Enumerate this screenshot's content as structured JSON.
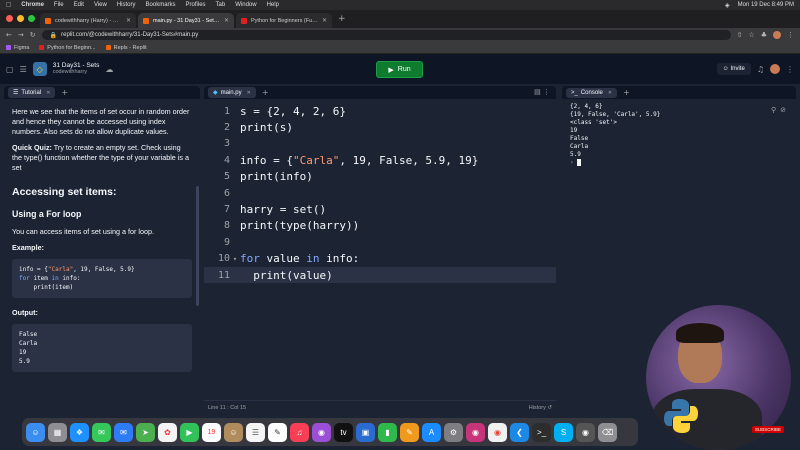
{
  "menubar": {
    "app": "Chrome",
    "items": [
      "File",
      "Edit",
      "View",
      "History",
      "Bookmarks",
      "Profiles",
      "Tab",
      "Window",
      "Help"
    ],
    "clock": "Mon 19 Dec 8:49 PM"
  },
  "tabs": [
    {
      "label": "codewithharry (Harry) - Replit",
      "icon": "replit-icon"
    },
    {
      "label": "main.py - 31 Day31 - Sets - Re...",
      "icon": "replit-icon"
    },
    {
      "label": "Python for Beginners (Full Co...",
      "icon": "youtube-icon"
    }
  ],
  "url": "replit.com/@codewithharry/31-Day31-Sets#main.py",
  "bookmarks": [
    "Figma",
    "Python for Beginn...",
    "Repls - Replit"
  ],
  "repl": {
    "title": "31 Day31 - Sets",
    "owner": "codewithharry",
    "run_label": "Run",
    "invite_label": "Invite"
  },
  "tutorial": {
    "tab_label": "Tutorial",
    "para1": "Here we see that the items of set occur in random order and hence they cannot be accessed using index numbers. Also sets do not allow duplicate values.",
    "quiz_label": "Quick Quiz:",
    "quiz_text": " Try to create an empty set. Check using the type() function whether the type of your variable is a set",
    "h2": "Accessing set items:",
    "h3": "Using a For loop",
    "para2": "You can access items of set using a for loop.",
    "example_label": "Example:",
    "example_code": [
      "info = {\"Carla\", 19, False, 5.9}",
      "for item in info:",
      "    print(item)"
    ],
    "output_label": "Output:",
    "output_lines": [
      "False",
      "Carla",
      "19",
      "5.9"
    ]
  },
  "editor": {
    "tab_label": "main.py",
    "lines": [
      "s = {2, 4, 2, 6}",
      "print(s)",
      "",
      "info = {\"Carla\", 19, False, 5.9, 19}",
      "print(info)",
      "",
      "harry = set()",
      "print(type(harry))",
      "",
      "for value in info:",
      "  print(value)"
    ],
    "status_position": "Line 11 : Col 15",
    "history_label": "History"
  },
  "console": {
    "tab_label": "Console",
    "lines": [
      "{2, 4, 6}",
      "{19, False, 'Carla', 5.9}",
      "<class 'set'>",
      "19",
      "False",
      "Carla",
      "5.9"
    ]
  },
  "overlay": {
    "subscribe_label": "SUBSCRIBE"
  },
  "colors": {
    "run_green": "#0f7b2f",
    "replit_bg": "#0e1525",
    "panel_bg": "#1c2333",
    "keyword": "#82aaff",
    "string": "#ff9a6e"
  }
}
